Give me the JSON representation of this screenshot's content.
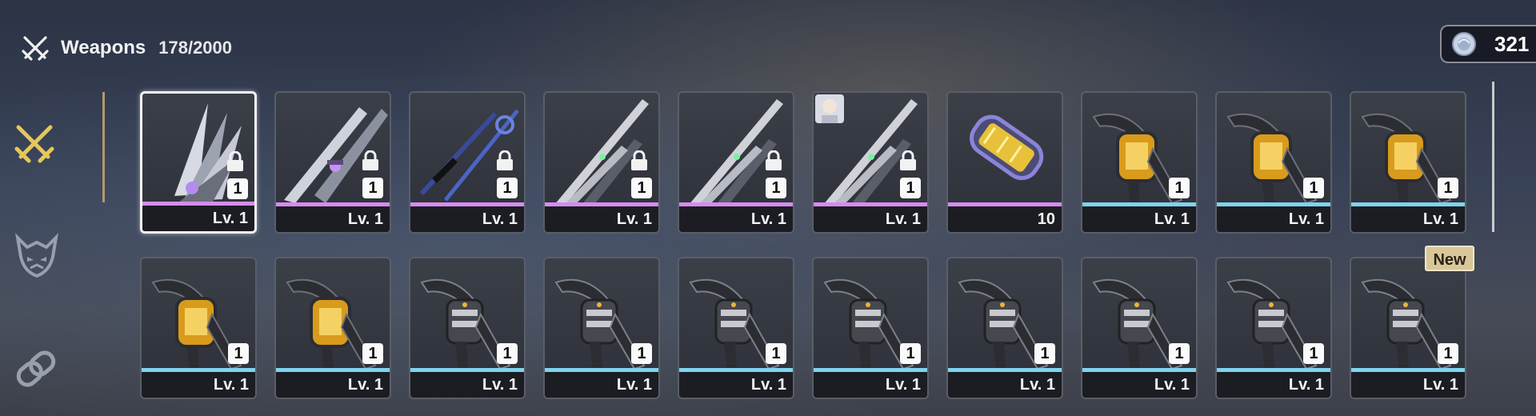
{
  "header": {
    "title": "Weapons",
    "count": "178/2000",
    "icon": "crossed-swords-icon"
  },
  "currency": {
    "value": "321",
    "icon": "coin-icon"
  },
  "sidebar": {
    "tabs": [
      {
        "name": "weapons-tab",
        "icon": "crossed-swords-icon",
        "active": true
      },
      {
        "name": "matrices-tab",
        "icon": "demon-mask-icon",
        "active": false
      },
      {
        "name": "gear-tab",
        "icon": "chain-link-icon",
        "active": false
      }
    ]
  },
  "colors": {
    "purple_rarity": "#d68cf0",
    "blue_rarity": "#7fd3ee",
    "accent_gold": "#b09a6a",
    "badge_new": "#d9c79a"
  },
  "items": [
    {
      "type": "crystal-blade",
      "rarity": "purple",
      "qty": "1",
      "level": "Lv. 1",
      "locked": true,
      "selected": true
    },
    {
      "type": "dual-blades",
      "rarity": "purple",
      "qty": "1",
      "level": "Lv. 1",
      "locked": true
    },
    {
      "type": "blue-staff",
      "rarity": "purple",
      "qty": "1",
      "level": "Lv. 1",
      "locked": true
    },
    {
      "type": "spear",
      "rarity": "purple",
      "qty": "1",
      "level": "Lv. 1",
      "locked": true
    },
    {
      "type": "spear",
      "rarity": "purple",
      "qty": "1",
      "level": "Lv. 1",
      "locked": true
    },
    {
      "type": "spear",
      "rarity": "purple",
      "qty": "1",
      "level": "Lv. 1",
      "locked": true,
      "avatar": true
    },
    {
      "type": "capsule",
      "rarity": "purple",
      "level": "10"
    },
    {
      "type": "gauntlet-gold",
      "rarity": "blue",
      "qty": "1",
      "level": "Lv. 1"
    },
    {
      "type": "gauntlet-gold",
      "rarity": "blue",
      "qty": "1",
      "level": "Lv. 1"
    },
    {
      "type": "gauntlet-gold",
      "rarity": "blue",
      "qty": "1",
      "level": "Lv. 1"
    },
    {
      "type": "gauntlet-gold",
      "rarity": "blue",
      "qty": "1",
      "level": "Lv. 1"
    },
    {
      "type": "gauntlet-gold",
      "rarity": "blue",
      "qty": "1",
      "level": "Lv. 1"
    },
    {
      "type": "gauntlet-dark",
      "rarity": "blue",
      "qty": "1",
      "level": "Lv. 1"
    },
    {
      "type": "gauntlet-dark",
      "rarity": "blue",
      "qty": "1",
      "level": "Lv. 1"
    },
    {
      "type": "gauntlet-dark",
      "rarity": "blue",
      "qty": "1",
      "level": "Lv. 1"
    },
    {
      "type": "gauntlet-dark",
      "rarity": "blue",
      "qty": "1",
      "level": "Lv. 1"
    },
    {
      "type": "gauntlet-dark",
      "rarity": "blue",
      "qty": "1",
      "level": "Lv. 1"
    },
    {
      "type": "gauntlet-dark",
      "rarity": "blue",
      "qty": "1",
      "level": "Lv. 1"
    },
    {
      "type": "gauntlet-dark",
      "rarity": "blue",
      "qty": "1",
      "level": "Lv. 1"
    },
    {
      "type": "gauntlet-dark",
      "rarity": "blue",
      "qty": "1",
      "level": "Lv. 1",
      "badge": "New"
    }
  ]
}
